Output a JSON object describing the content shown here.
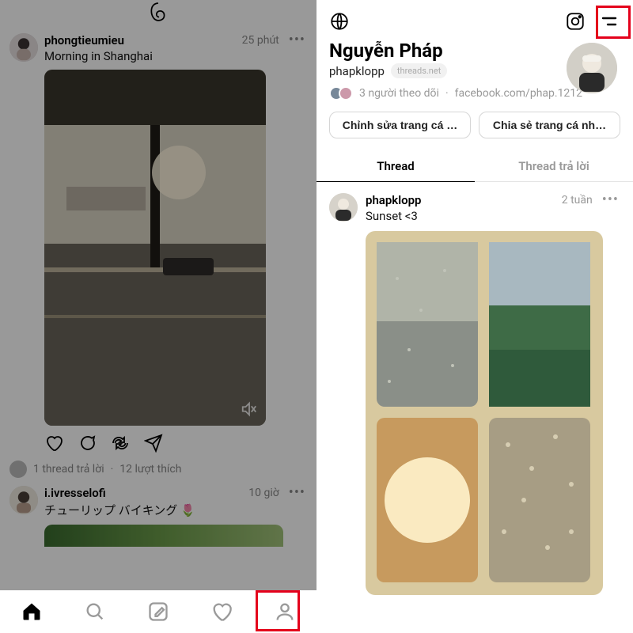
{
  "left": {
    "post1": {
      "username": "phongtieumieu",
      "timestamp": "25 phút",
      "caption": "Morning in Shanghai"
    },
    "meta": {
      "replies": "1 thread trả lời",
      "sep": "·",
      "likes": "12 lượt thích"
    },
    "post2": {
      "username": "i.ivresselofi",
      "timestamp": "10 giờ",
      "caption": "チューリップ バイキング 🌷"
    }
  },
  "right": {
    "display_name": "Nguyễn Pháp",
    "handle": "phapklopp",
    "domain_badge": "threads.net",
    "followers_text": "3 người theo dõi",
    "sep": "·",
    "link_text": "facebook.com/phap.1212",
    "edit_btn": "Chỉnh sửa trang cá …",
    "share_btn": "Chia sẻ trang cá nh…",
    "tab_threads": "Thread",
    "tab_replies": "Thread trả lời",
    "post": {
      "username": "phapklopp",
      "timestamp": "2 tuần",
      "caption": "Sunset <3"
    }
  }
}
